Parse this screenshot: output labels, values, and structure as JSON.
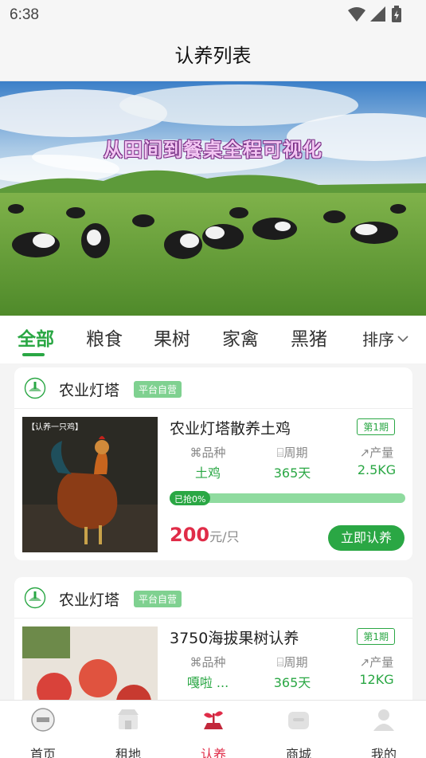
{
  "status": {
    "time": "6:38"
  },
  "header": {
    "title": "认养列表"
  },
  "banner": {
    "text": "从田间到餐桌全程可视化"
  },
  "tabs": {
    "items": [
      "全部",
      "粮食",
      "果树",
      "家禽",
      "黑猪"
    ],
    "active": "全部",
    "sort_label": "排序"
  },
  "cards": [
    {
      "shop": "农业灯塔",
      "badge": "平台自营",
      "image_tag": "【认养一只鸡】",
      "name": "农业灯塔散养土鸡",
      "period": "第1期",
      "specs": [
        {
          "label": "品种",
          "value": "土鸡"
        },
        {
          "label": "周期",
          "value": "365天"
        },
        {
          "label": "产量",
          "value": "2.5KG"
        }
      ],
      "progress_label": "已抢0%",
      "progress": 0,
      "price": "200",
      "price_unit": "元/只",
      "button": "立即认养"
    },
    {
      "shop": "农业灯塔",
      "badge": "平台自营",
      "name": "3750海拔果树认养",
      "period": "第1期",
      "specs": [
        {
          "label": "品种",
          "value": "嘎啦 ..."
        },
        {
          "label": "周期",
          "value": "365天"
        },
        {
          "label": "产量",
          "value": "12KG"
        }
      ]
    }
  ],
  "bottom_nav": {
    "items": [
      "首页",
      "租地",
      "认养",
      "商城",
      "我的"
    ],
    "active": "认养"
  },
  "colors": {
    "accent": "#2aa744",
    "price": "#e02c48",
    "active_nav": "#e02c48"
  }
}
